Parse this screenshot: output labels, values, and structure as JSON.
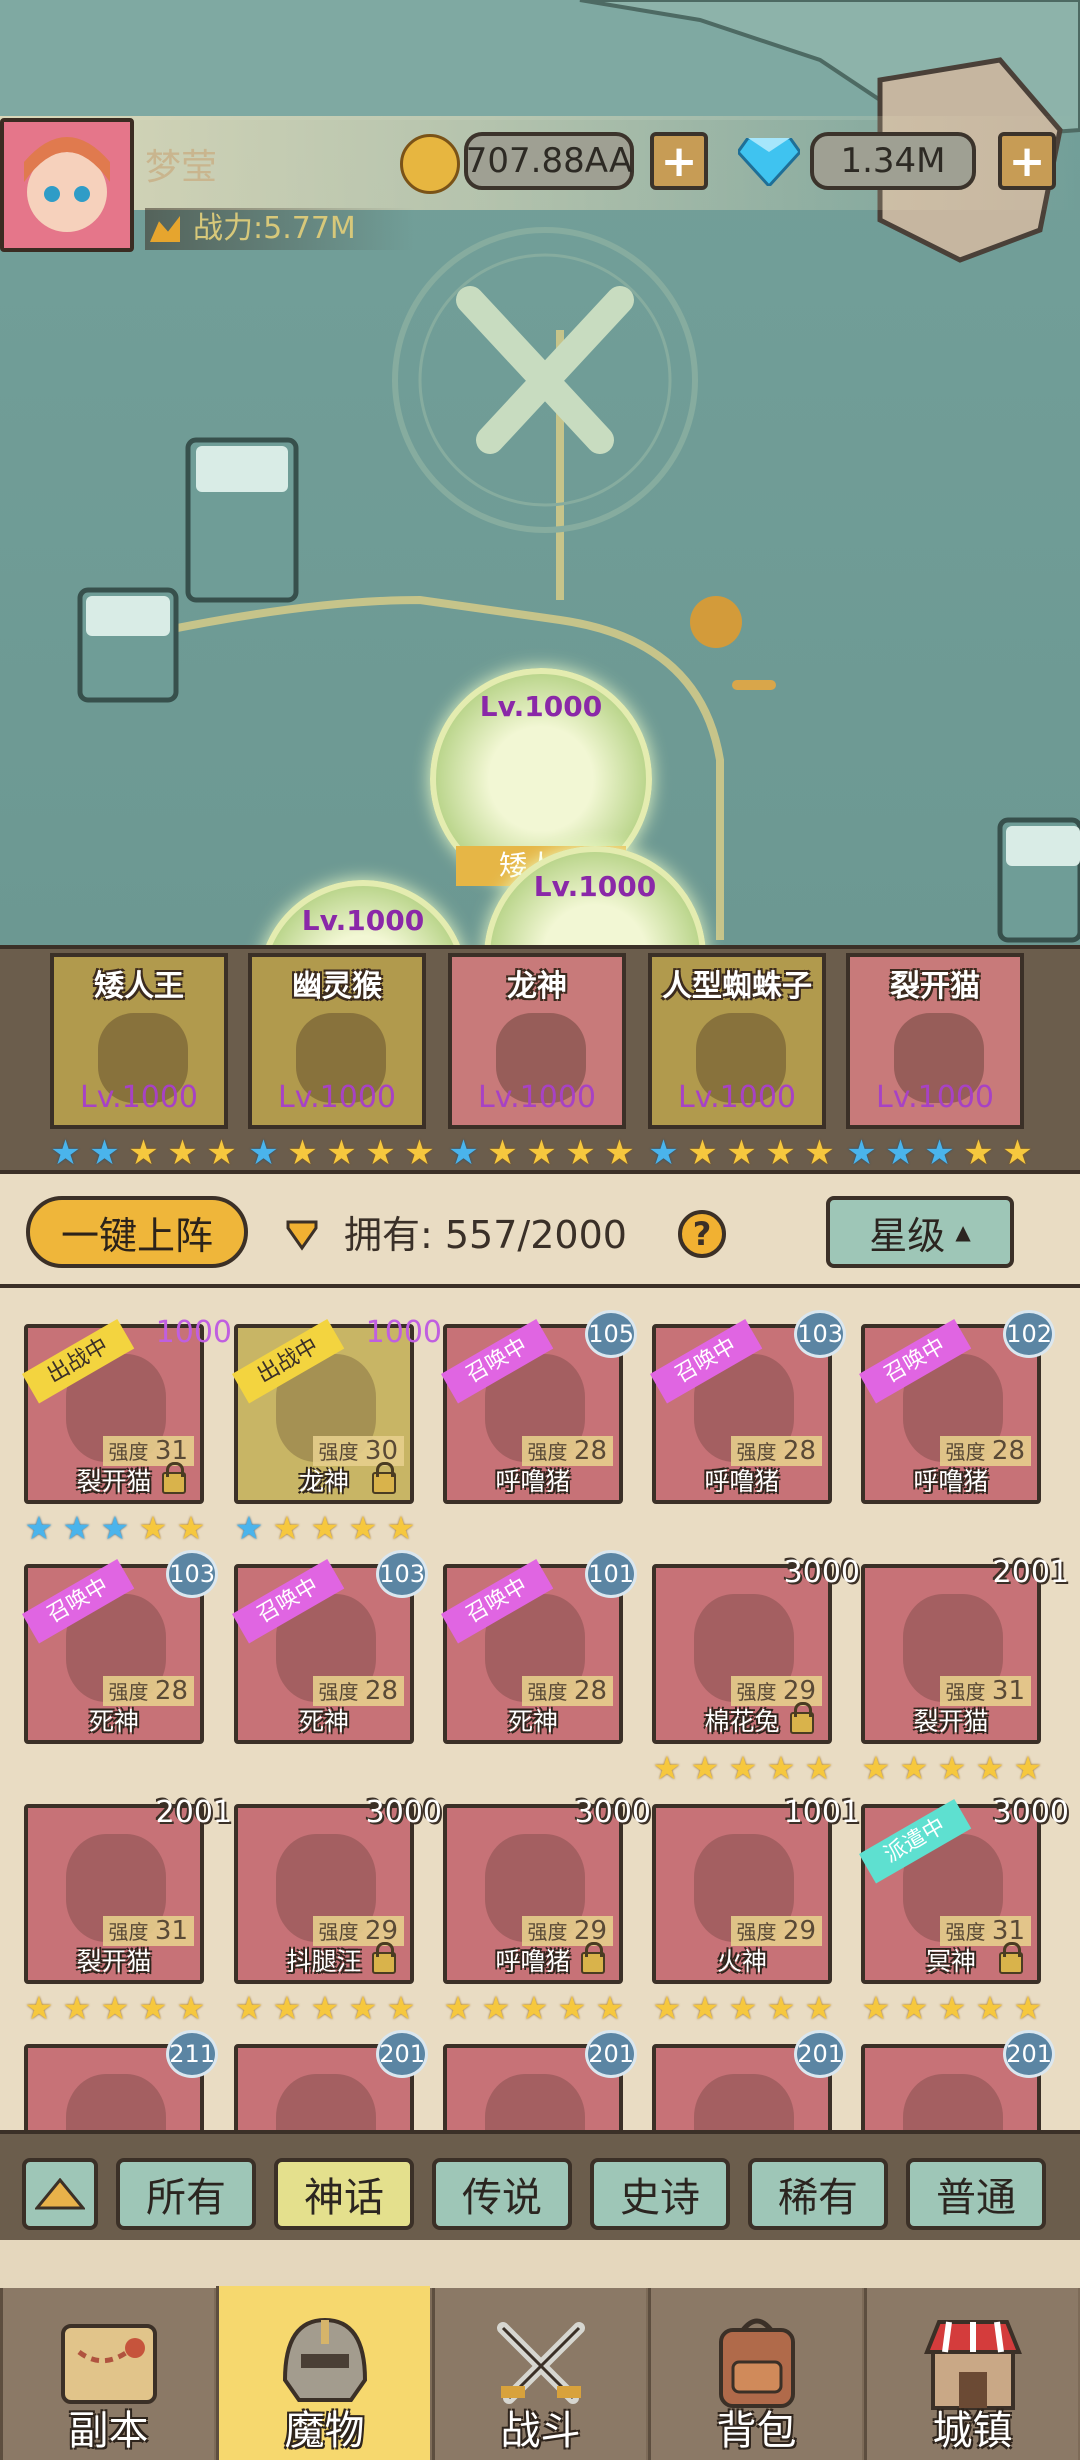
{
  "header": {
    "player_name": "梦莹",
    "gold": "707.88AA",
    "gems": "1.34M",
    "power": "战力:5.77M"
  },
  "map_nodes": [
    {
      "level": "Lv.1000",
      "label": "矮人王"
    },
    {
      "level": "Lv.1000"
    },
    {
      "level": "Lv.1000"
    }
  ],
  "lineup": [
    {
      "name": "矮人王",
      "level": "Lv.1000",
      "stars": [
        "blue",
        "blue",
        "gold",
        "gold",
        "gold"
      ]
    },
    {
      "name": "幽灵猴",
      "level": "Lv.1000",
      "stars": [
        "blue",
        "gold",
        "gold",
        "gold",
        "gold"
      ]
    },
    {
      "name": "龙神",
      "level": "Lv.1000",
      "stars": [
        "blue",
        "gold",
        "gold",
        "gold",
        "gold"
      ]
    },
    {
      "name": "人型蜘蛛子",
      "level": "Lv.1000",
      "stars": [
        "blue",
        "gold",
        "gold",
        "gold",
        "gold"
      ]
    },
    {
      "name": "裂开猫",
      "level": "Lv.1000",
      "stars": [
        "blue",
        "blue",
        "blue",
        "gold",
        "gold"
      ]
    }
  ],
  "inventory_header": {
    "deploy_all": "一键上阵",
    "owned_label": "拥有: 557/2000",
    "sort_label": "星级"
  },
  "strength_label": "强度",
  "monsters": [
    {
      "name": "裂开猫",
      "strength": "31",
      "count": "1000",
      "tag": "出战中",
      "tag_type": "deploy",
      "stars": [
        "blue",
        "blue",
        "blue",
        "gold",
        "gold"
      ],
      "locked": true
    },
    {
      "name": "龙神",
      "strength": "30",
      "count": "1000",
      "tag": "出战中",
      "tag_type": "deploy",
      "stars": [
        "blue",
        "gold",
        "gold",
        "gold",
        "gold"
      ],
      "locked": true
    },
    {
      "name": "呼噜猪",
      "strength": "28",
      "count": "105",
      "tag": "召唤中",
      "tag_type": "summon",
      "stars": [],
      "locked": false
    },
    {
      "name": "呼噜猪",
      "strength": "28",
      "count": "103",
      "tag": "召唤中",
      "tag_type": "summon",
      "stars": [],
      "locked": false
    },
    {
      "name": "呼噜猪",
      "strength": "28",
      "count": "102",
      "tag": "召唤中",
      "tag_type": "summon",
      "stars": [],
      "locked": false
    },
    {
      "name": "死神",
      "strength": "28",
      "count": "103",
      "tag": "召唤中",
      "tag_type": "summon",
      "stars": [],
      "locked": false
    },
    {
      "name": "死神",
      "strength": "28",
      "count": "103",
      "tag": "召唤中",
      "tag_type": "summon",
      "stars": [],
      "locked": false
    },
    {
      "name": "死神",
      "strength": "28",
      "count": "101",
      "tag": "召唤中",
      "tag_type": "summon",
      "stars": [],
      "locked": false
    },
    {
      "name": "棉花兔",
      "strength": "29",
      "count": "3000",
      "tag": "",
      "tag_type": "",
      "stars": [
        "gold",
        "gold",
        "gold",
        "gold",
        "gold"
      ],
      "locked": true
    },
    {
      "name": "裂开猫",
      "strength": "31",
      "count": "2001",
      "tag": "",
      "tag_type": "",
      "stars": [
        "gold",
        "gold",
        "gold",
        "gold",
        "gold"
      ],
      "locked": false
    },
    {
      "name": "裂开猫",
      "strength": "31",
      "count": "2001",
      "tag": "",
      "tag_type": "",
      "stars": [
        "gold",
        "gold",
        "gold",
        "gold",
        "gold"
      ],
      "locked": false
    },
    {
      "name": "抖腿汪",
      "strength": "29",
      "count": "3000",
      "tag": "",
      "tag_type": "",
      "stars": [
        "gold",
        "gold",
        "gold",
        "gold",
        "gold"
      ],
      "locked": true
    },
    {
      "name": "呼噜猪",
      "strength": "29",
      "count": "3000",
      "tag": "",
      "tag_type": "",
      "stars": [
        "gold",
        "gold",
        "gold",
        "gold",
        "gold"
      ],
      "locked": true
    },
    {
      "name": "火神",
      "strength": "29",
      "count": "1001",
      "tag": "",
      "tag_type": "",
      "stars": [
        "gold",
        "gold",
        "gold",
        "gold",
        "gold"
      ],
      "locked": false
    },
    {
      "name": "冥神",
      "strength": "31",
      "count": "3000",
      "tag": "派遣中",
      "tag_type": "dispatch",
      "stars": [
        "gold",
        "gold",
        "gold",
        "gold",
        "gold"
      ],
      "locked": true
    },
    {
      "name": "",
      "strength": "",
      "count": "211",
      "tag": "",
      "tag_type": "",
      "stars": [],
      "locked": false
    },
    {
      "name": "",
      "strength": "",
      "count": "201",
      "tag": "",
      "tag_type": "",
      "stars": [],
      "locked": false
    },
    {
      "name": "",
      "strength": "",
      "count": "201",
      "tag": "",
      "tag_type": "",
      "stars": [],
      "locked": false
    },
    {
      "name": "",
      "strength": "",
      "count": "201",
      "tag": "",
      "tag_type": "",
      "stars": [],
      "locked": false
    },
    {
      "name": "",
      "strength": "",
      "count": "201",
      "tag": "",
      "tag_type": "",
      "stars": [],
      "locked": false
    }
  ],
  "filters": [
    "所有",
    "神话",
    "传说",
    "史诗",
    "稀有",
    "普通"
  ],
  "active_filter": "神话",
  "nav": [
    {
      "label": "副本",
      "icon": "map-icon"
    },
    {
      "label": "魔物",
      "icon": "helmet-icon"
    },
    {
      "label": "战斗",
      "icon": "crossed-swords-icon"
    },
    {
      "label": "背包",
      "icon": "backpack-icon"
    },
    {
      "label": "城镇",
      "icon": "shop-icon"
    }
  ],
  "active_nav": "魔物",
  "colors": {
    "gold_star": "#f6c83e",
    "blue_star": "#4ab4ec",
    "active_tab": "#f6d86e"
  }
}
